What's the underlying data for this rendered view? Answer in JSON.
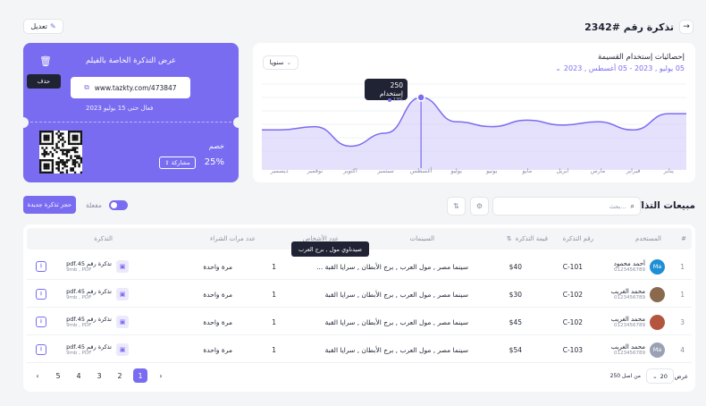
{
  "header": {
    "title": "تذكرة رقم #2342",
    "edit_label": "تعديل"
  },
  "stats": {
    "title": "إحصائيات إستخدام القسيمة",
    "date_range": "05 يوليو , 2023 - 05 أغسطس , 2023",
    "period_select": "سنويا",
    "tooltip_value": "250 إستخدام",
    "tooltip_sub": "13%",
    "months": [
      "يناير",
      "فبراير",
      "مارس",
      "ابريل",
      "مايو",
      "يونيو",
      "يوليو",
      "أغسطس",
      "سبتمبر",
      "اكتوبر",
      "نوفمبر",
      "ديسمبر"
    ]
  },
  "chart_data": {
    "type": "area",
    "categories": [
      "يناير",
      "فبراير",
      "مارس",
      "ابريل",
      "مايو",
      "يونيو",
      "يوليو",
      "أغسطس",
      "سبتمبر",
      "اكتوبر",
      "نوفمبر",
      "ديسمبر"
    ],
    "series": [
      {
        "values": [
          200,
          150,
          175,
          165,
          180,
          160,
          175,
          250,
          140,
          100,
          160,
          150
        ]
      }
    ],
    "annotation": {
      "category": "أغسطس",
      "label": "250 إستخدام",
      "sub": "13%"
    },
    "accent": "#7a6cf0"
  },
  "ticket": {
    "title": "عرض التذكرة الخاصة بالفيلم",
    "link": "www.tazkty.com/473847",
    "valid_until": "فعال حتى 15 يوليو 2023",
    "delete_tooltip": "حذف",
    "discount_label": "خصم",
    "discount_value": "25%",
    "share_label": "مشاركة"
  },
  "sales": {
    "title": "مبيعات التذاكر",
    "search_placeholder": "بحث...",
    "toggle_label": "مفعلة",
    "new_ticket": "حجز تذكرة جديدة",
    "hover_tooltip": "صيدناوي مول , برج العرب",
    "columns": [
      "#",
      "المستخدم",
      "رقم التذكرة",
      "قيمة التذكرة",
      "السينمات",
      "عدد الأشخاص",
      "عدد مرات الشراء",
      "التذكرة"
    ],
    "rows": [
      {
        "num": "1",
        "avatar": "Ma",
        "name": "أحمد محمود",
        "phone": "0123456789",
        "ticket_no": "C-101",
        "price": "$40",
        "cinemas": "سينما مصر , مول العرب , برج الأبطان , سرايا القبة ...",
        "persons": "1",
        "purchases": "مرة واحدة",
        "file": "تذكرة رقم 45.pdf",
        "meta": "9mb , PDF"
      },
      {
        "num": "1",
        "avatar": "",
        "name": "محمد الغريب",
        "phone": "0123456789",
        "ticket_no": "C-102",
        "price": "$30",
        "cinemas": "سينما مصر , مول العرب , برج الأبطان , سرايا القبة",
        "persons": "1",
        "purchases": "مرة واحدة",
        "file": "تذكرة رقم 45.pdf",
        "meta": "9mb , PDF"
      },
      {
        "num": "3",
        "avatar": "",
        "name": "محمد الغريب",
        "phone": "0123456789",
        "ticket_no": "C-102",
        "price": "$45",
        "cinemas": "سينما مصر , مول العرب , برج الأبطان , سرايا القبة",
        "persons": "1",
        "purchases": "مرة واحدة",
        "file": "تذكرة رقم 45.pdf",
        "meta": "9mb , PDF"
      },
      {
        "num": "4",
        "avatar": "Ma",
        "name": "محمد الغريب",
        "phone": "0123456789",
        "ticket_no": "C-103",
        "price": "$54",
        "cinemas": "سينما مصر , مول العرب , برج الأبطان , سرايا القبة",
        "persons": "1",
        "purchases": "مرة واحدة",
        "file": "تذكرة رقم 45.pdf",
        "meta": "9mb , PDF"
      }
    ]
  },
  "pagination": {
    "show_label": "عرض",
    "per_page": "20",
    "of_total": "من اصل 250",
    "pages": [
      "1",
      "2",
      "3",
      "4",
      "5"
    ]
  }
}
